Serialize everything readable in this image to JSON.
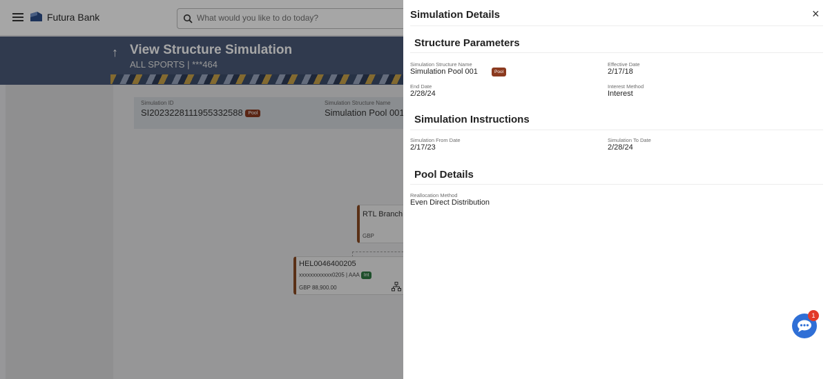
{
  "app": {
    "brand": "Futura Bank",
    "search_placeholder": "What would you like to do today?",
    "page_title": "View Structure Simulation",
    "page_subtitle": "ALL SPORTS | ***464",
    "info": {
      "simulation_id_label": "Simulation ID",
      "simulation_id": "SI20232281119553325​88",
      "simulation_id_badge": "Pool",
      "structure_name_label": "Simulation Structure Name",
      "structure_name": "Simulation Pool 001"
    },
    "nodes": {
      "rtl": {
        "name": "RTL Branch",
        "currency": "GBP"
      },
      "hel": {
        "name": "HEL0046400205",
        "account": "xxxxxxxxxxxx0205 | AAA",
        "badge": "Int",
        "balance": "GBP 88,900.00"
      }
    },
    "chat_count": "1"
  },
  "panel": {
    "title": "Simulation Details",
    "close": "×",
    "structure_parameters": {
      "title": "Structure Parameters",
      "structure_name_label": "Simulation Structure Name",
      "structure_name": "Simulation Pool 001",
      "structure_badge": "Pool",
      "effective_date_label": "Effective Date",
      "effective_date": "2/17/18",
      "end_date_label": "End Date",
      "end_date": "2/28/24",
      "interest_method_label": "Interest Method",
      "interest_method": "Interest"
    },
    "simulation_instructions": {
      "title": "Simulation Instructions",
      "from_label": "Simulation From Date",
      "from_date": "2/17/23",
      "to_label": "Simulation To Date",
      "to_date": "2/28/24"
    },
    "pool_details": {
      "title": "Pool Details",
      "reallocation_label": "Reallocation Method",
      "reallocation_value": "Even Direct Distribution"
    }
  },
  "colors": {
    "header": "#4a5a78",
    "pool_badge": "#8b3a1f",
    "int_badge": "#2f7a43",
    "chat": "#2f6fd6"
  }
}
